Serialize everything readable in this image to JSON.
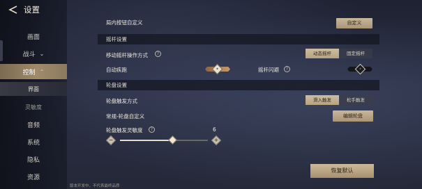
{
  "header": {
    "title": "设置",
    "back_icon": "back-arrow-icon"
  },
  "sidebar": {
    "items": [
      {
        "label": "画面"
      },
      {
        "label": "战斗",
        "chevron": "⌄"
      },
      {
        "label": "控制",
        "chevron": "⌃"
      },
      {
        "label": "界面"
      },
      {
        "label": "灵敏度"
      },
      {
        "label": "音频"
      },
      {
        "label": "系统"
      },
      {
        "label": "隐私"
      },
      {
        "label": "资源"
      }
    ]
  },
  "main": {
    "top_row": {
      "label": "局内按钮自定义",
      "button": "自定义"
    },
    "joystick_section": {
      "title": "摇杆设置"
    },
    "move_mode": {
      "label": "移动摇杆操作方式",
      "options": [
        "动态摇杆",
        "固定摇杆"
      ],
      "selected": "动态摇杆"
    },
    "auto_run": {
      "label": "自动疾跑",
      "on": true
    },
    "dodge": {
      "label": "摇杆闪避",
      "on": false
    },
    "wheel_section": {
      "title": "轮盘设置"
    },
    "wheel_trigger": {
      "label": "轮盘触发方式",
      "options": [
        "滑入触发",
        "松手触发"
      ],
      "selected": "滑入触发"
    },
    "wheel_custom": {
      "label": "常规-轮盘自定义",
      "button": "编辑轮盘"
    },
    "wheel_sensitivity": {
      "label": "轮盘触发灵敏度",
      "value": "6",
      "fraction": 0.6,
      "minus": "−",
      "plus": "+"
    },
    "restore_button": "恢复默认"
  },
  "footer_note": "版本开发中，不代表最终品质",
  "colors": {
    "accent": "#a99476",
    "active_tab": "#a08a69",
    "toggle_on": "#b88e63",
    "toggle_off": "#15161c"
  }
}
